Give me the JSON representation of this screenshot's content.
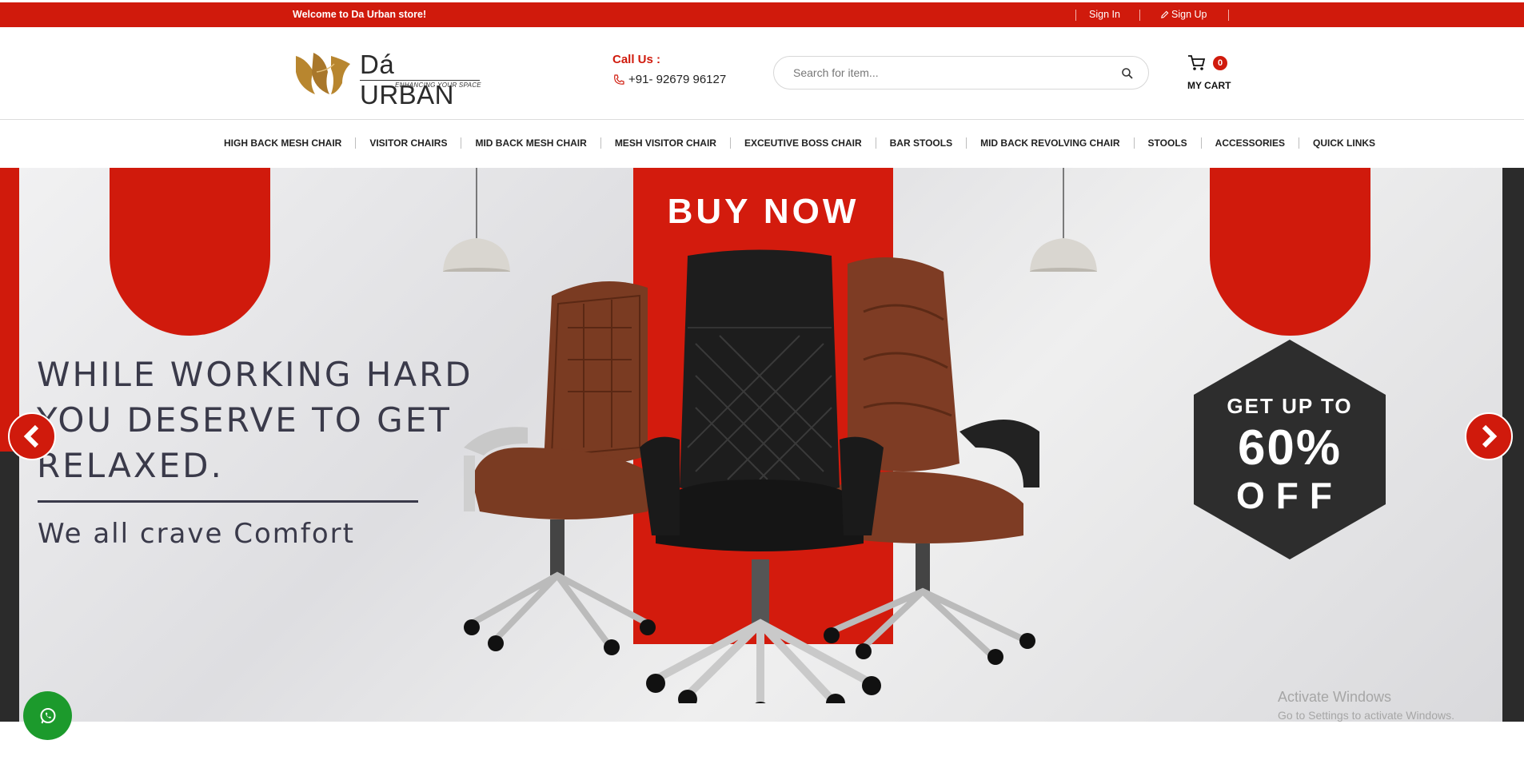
{
  "topbar": {
    "welcome": "Welcome to Da Urban store!",
    "sign_in": "Sign In",
    "sign_up": "Sign Up"
  },
  "header": {
    "logo_brand": "Dá URBAN",
    "logo_tagline": "ENHANCING YOUR SPACE",
    "call_label": "Call Us :",
    "phone": "+91- 92679 96127",
    "search_placeholder": "Search for item...",
    "cart_count": "0",
    "cart_label": "MY CART"
  },
  "nav": {
    "items": [
      "HIGH BACK MESH CHAIR",
      "VISITOR CHAIRS",
      "MID BACK MESH CHAIR",
      "MESH VISITOR CHAIR",
      "EXCEUTIVE BOSS CHAIR",
      "BAR STOOLS",
      "MID BACK REVOLVING CHAIR",
      "STOOLS",
      "ACCESSORIES",
      "QUICK LINKS"
    ]
  },
  "hero": {
    "buy_now": "BUY NOW",
    "headline": "WHILE WORKING HARD\nYOU DESERVE TO GET\nRELAXED.",
    "subline": "We all crave Comfort",
    "offer_line1": "GET UP TO",
    "offer_line2": "60%",
    "offer_line3": "OFF"
  },
  "watermark": {
    "line1": "Activate Windows",
    "line2": "Go to Settings to activate Windows."
  },
  "colors": {
    "brand_red": "#d01a0c",
    "dark": "#2b2b2b",
    "whatsapp_green": "#1c9a2c",
    "logo_gold": "#b8862f"
  }
}
